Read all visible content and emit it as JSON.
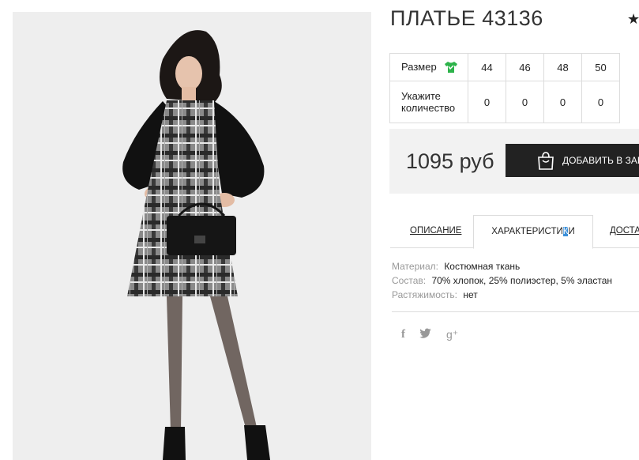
{
  "product": {
    "title": "ПЛАТЬЕ 43136"
  },
  "sizes": {
    "size_label": "Размер",
    "qty_label": "Укажите количество",
    "values": [
      "44",
      "46",
      "48",
      "50"
    ],
    "quantities": [
      "0",
      "0",
      "0",
      "0"
    ]
  },
  "purchase": {
    "price": "1095 руб",
    "add_button": "ДОБАВИТЬ В ЗАКАЗ"
  },
  "tabs": {
    "description": "ОПИСАНИЕ",
    "char_a": "ХАРАКТЕРИСТИ",
    "char_b": "К",
    "char_c": "И",
    "delivery": "ДОСТАВКА"
  },
  "specs": [
    {
      "key": "Материал:",
      "value": "Костюмная ткань"
    },
    {
      "key": "Состав:",
      "value": "70% хлопок, 25% полиэстер, 5% эластан"
    },
    {
      "key": "Растяжимость:",
      "value": "нет"
    }
  ],
  "social": {
    "facebook": "f",
    "google": "g⁺"
  },
  "colors": {
    "button_bg": "#222222",
    "price_bg": "#f2f2f2",
    "size_icon": "#2db34a",
    "tab_highlight": "#3a8fd9"
  }
}
